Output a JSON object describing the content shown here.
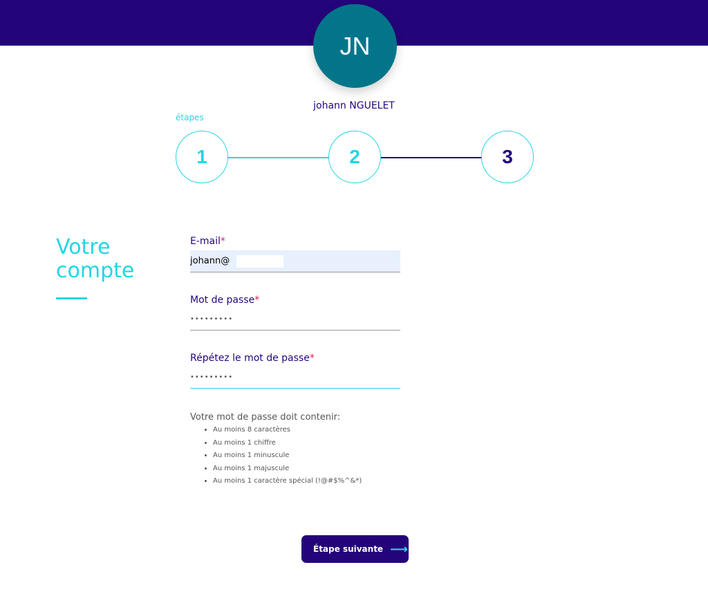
{
  "header": {
    "avatar_initials": "JN",
    "username": "johann NGUELET"
  },
  "stepper": {
    "label": "étapes",
    "steps": [
      "1",
      "2",
      "3"
    ]
  },
  "section": {
    "title_line1": "Votre",
    "title_line2": "compte"
  },
  "form": {
    "email_label": "E-mail",
    "email_value": "johann@",
    "password_label": "Mot de passe",
    "password_value": "•••••••••",
    "repeat_label": "Répétez le mot de passe",
    "repeat_value": "•••••••••",
    "required_mark": "*"
  },
  "rules": {
    "title": "Votre mot de passe doit contenir:",
    "items": [
      "Au moins 8 caractères",
      "Au moins 1 chiffre",
      "Au moins 1 minuscule",
      "Au moins 1 majuscule",
      "Au moins 1 caractère spécial (!@#$%^&*)"
    ]
  },
  "actions": {
    "next_label": "Étape suivante",
    "next_icon": "arrow-right-icon"
  },
  "colors": {
    "header_bg": "#24047a",
    "accent": "#22d6e6",
    "avatar_bg": "#03758a",
    "required": "#e02050"
  }
}
